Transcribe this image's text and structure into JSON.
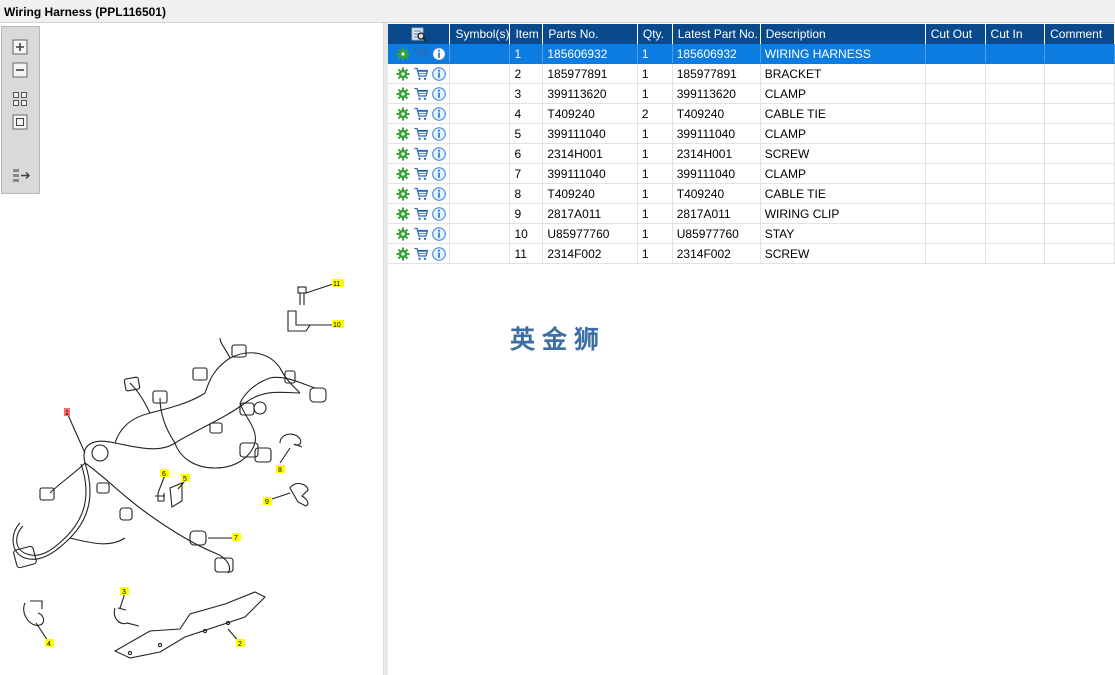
{
  "window": {
    "title": "Wiring Harness (PPL116501)"
  },
  "toolbar": {
    "tools": [
      {
        "name": "zoom-in-icon"
      },
      {
        "name": "zoom-out-icon"
      },
      {
        "name": "fit-all-icon"
      },
      {
        "name": "fit-page-icon"
      },
      {
        "name": "export-icon"
      }
    ]
  },
  "diagram": {
    "callouts": [
      "1",
      "2",
      "3",
      "4",
      "5",
      "6",
      "7",
      "8",
      "9",
      "10",
      "11"
    ],
    "colors": {
      "callout_bg": "#ffff00",
      "callout_main_bg": "#ff6b6b"
    }
  },
  "grid": {
    "columns": {
      "actions_icon": "search-list-icon",
      "symbols": "Symbol(s)",
      "item": "Item",
      "parts_no": "Parts No.",
      "qty": "Qty.",
      "latest_part_no": "Latest Part No.",
      "description": "Description",
      "cut_out": "Cut Out",
      "cut_in": "Cut In",
      "comment": "Comment"
    },
    "rows": [
      {
        "item": "1",
        "parts_no": "185606932",
        "qty": "1",
        "latest": "185606932",
        "description": "WIRING HARNESS"
      },
      {
        "item": "2",
        "parts_no": "185977891",
        "qty": "1",
        "latest": "185977891",
        "description": "BRACKET"
      },
      {
        "item": "3",
        "parts_no": "399113620",
        "qty": "1",
        "latest": "399113620",
        "description": "CLAMP"
      },
      {
        "item": "4",
        "parts_no": "T409240",
        "qty": "2",
        "latest": "T409240",
        "description": "CABLE TIE"
      },
      {
        "item": "5",
        "parts_no": "399111040",
        "qty": "1",
        "latest": "399111040",
        "description": "CLAMP"
      },
      {
        "item": "6",
        "parts_no": "2314H001",
        "qty": "1",
        "latest": "2314H001",
        "description": "SCREW"
      },
      {
        "item": "7",
        "parts_no": "399111040",
        "qty": "1",
        "latest": "399111040",
        "description": "CLAMP"
      },
      {
        "item": "8",
        "parts_no": "T409240",
        "qty": "1",
        "latest": "T409240",
        "description": "CABLE TIE"
      },
      {
        "item": "9",
        "parts_no": "2817A011",
        "qty": "1",
        "latest": "2817A011",
        "description": "WIRING CLIP"
      },
      {
        "item": "10",
        "parts_no": "U85977760",
        "qty": "1",
        "latest": "U85977760",
        "description": "STAY"
      },
      {
        "item": "11",
        "parts_no": "2314F002",
        "qty": "1",
        "latest": "2314F002",
        "description": "SCREW"
      }
    ],
    "selected_row": 1,
    "row_icons": [
      "gear-icon",
      "cart-icon",
      "info-icon"
    ]
  },
  "watermark": {
    "text": "英金狮"
  },
  "colors": {
    "header_bg": "#0a4a8c",
    "selected_row_bg": "#0d7ce0",
    "gear": "#3aa335",
    "cart": "#2a6db5",
    "info": "#2b7bd6"
  }
}
